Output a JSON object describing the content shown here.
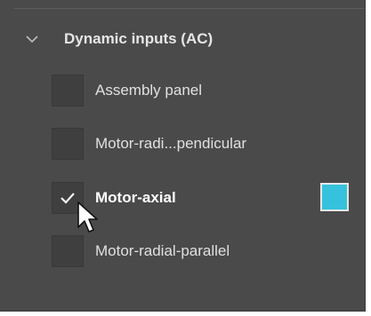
{
  "section": {
    "title": "Dynamic inputs (AC)",
    "expanded": true,
    "items": [
      {
        "label": "Assembly panel",
        "checked": false
      },
      {
        "label": "Motor-radi...pendicular",
        "checked": false
      },
      {
        "label": "Motor-axial",
        "checked": true,
        "color": "#36c2dc"
      },
      {
        "label": "Motor-radial-parallel",
        "checked": false
      }
    ]
  },
  "icons": {
    "chevron": "chevron-down-icon",
    "check": "checkmark-icon",
    "cursor": "mouse-pointer-icon"
  },
  "colors": {
    "panel_background": "#4a4a4a",
    "checkbox_background": "#3f3f3f",
    "accent_swatch": "#36c2dc"
  }
}
